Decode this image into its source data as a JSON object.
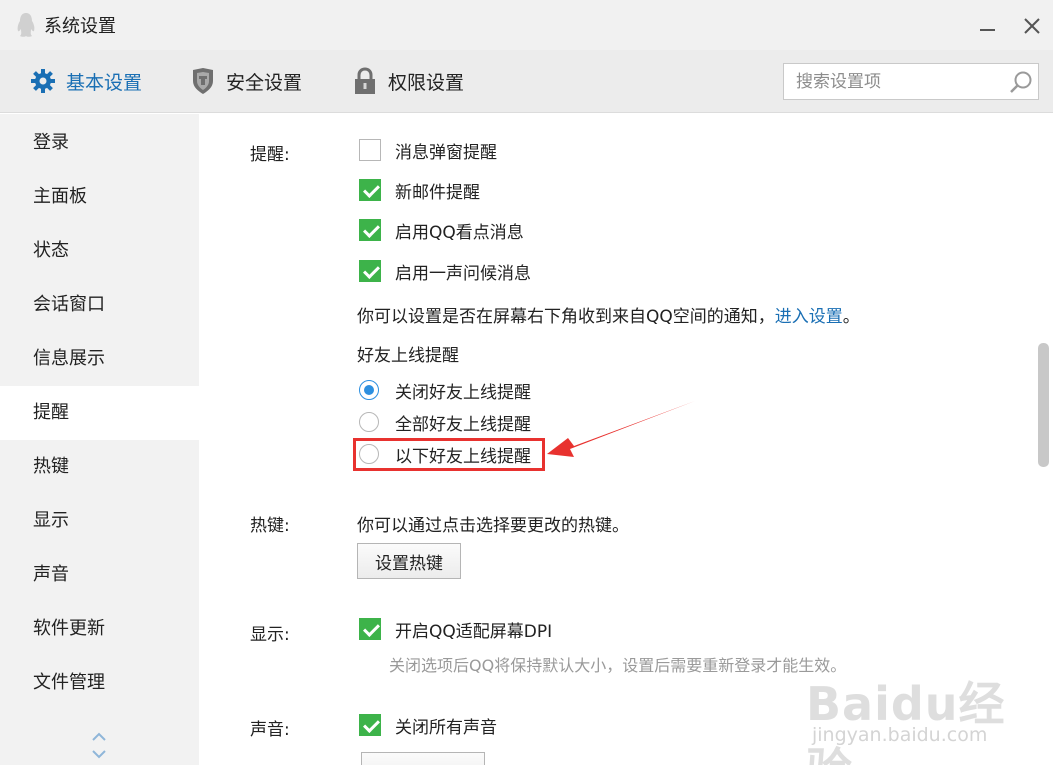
{
  "window": {
    "title": "系统设置"
  },
  "header": {
    "tabs": [
      {
        "label": "基本设置",
        "icon": "gear-icon",
        "active": true
      },
      {
        "label": "安全设置",
        "icon": "shield-icon",
        "active": false
      },
      {
        "label": "权限设置",
        "icon": "lock-icon",
        "active": false
      }
    ],
    "search": {
      "placeholder": "搜索设置项",
      "value": ""
    }
  },
  "sidebar": {
    "items": [
      {
        "label": "登录"
      },
      {
        "label": "主面板"
      },
      {
        "label": "状态"
      },
      {
        "label": "会话窗口"
      },
      {
        "label": "信息展示"
      },
      {
        "label": "提醒",
        "active": true
      },
      {
        "label": "热键"
      },
      {
        "label": "显示"
      },
      {
        "label": "声音"
      },
      {
        "label": "软件更新"
      },
      {
        "label": "文件管理"
      }
    ]
  },
  "content": {
    "reminder": {
      "label": "提醒:",
      "options": [
        {
          "label": "消息弹窗提醒",
          "checked": false
        },
        {
          "label": "新邮件提醒",
          "checked": true
        },
        {
          "label": "启用QQ看点消息",
          "checked": true
        },
        {
          "label": "启用一声问候消息",
          "checked": true
        }
      ],
      "qzone_note": "你可以设置是否在屏幕右下角收到来自QQ空间的通知，",
      "qzone_link": "进入设置",
      "qzone_end": "。",
      "friend_online_title": "好友上线提醒",
      "friend_options": [
        {
          "label": "关闭好友上线提醒",
          "selected": true
        },
        {
          "label": "全部好友上线提醒",
          "selected": false
        },
        {
          "label": "以下好友上线提醒",
          "selected": false
        }
      ]
    },
    "hotkey": {
      "label": "热键:",
      "note": "你可以通过点击选择要更改的热键。",
      "button": "设置热键"
    },
    "display": {
      "label": "显示:",
      "option": {
        "label": "开启QQ适配屏幕DPI",
        "checked": true
      },
      "hint": "关闭选项后QQ将保持默认大小，设置后需要重新登录才能生效。"
    },
    "sound": {
      "label": "声音:",
      "option": {
        "label": "关闭所有声音",
        "checked": true
      }
    }
  },
  "watermark": {
    "logo": "Baidu经验",
    "url": "jingyan.baidu.com"
  },
  "colors": {
    "accent": "#1a6fb4",
    "check_green": "#3db34a",
    "radio_blue": "#2c8fe0",
    "annotation_red": "#e8322f"
  }
}
